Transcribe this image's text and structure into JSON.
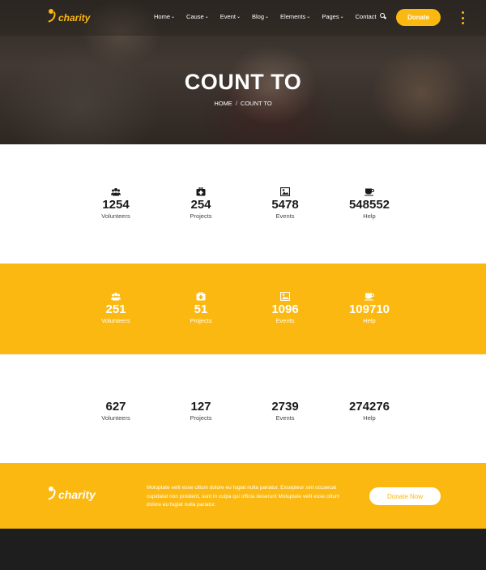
{
  "brand": {
    "name": "charity",
    "accent": "#fbb811"
  },
  "nav": {
    "items": [
      {
        "label": "Home",
        "has_dropdown": true
      },
      {
        "label": "Cause",
        "has_dropdown": true
      },
      {
        "label": "Event",
        "has_dropdown": true
      },
      {
        "label": "Blog",
        "has_dropdown": true
      },
      {
        "label": "Elements",
        "has_dropdown": true
      },
      {
        "label": "Pages",
        "has_dropdown": true
      },
      {
        "label": "Contact",
        "has_dropdown": false
      }
    ],
    "search_icon": "search-icon",
    "donate_label": "Donate",
    "menu_icon": "kebab-menu-icon"
  },
  "hero": {
    "title": "COUNT TO",
    "breadcrumb": [
      "HOME",
      "COUNT TO"
    ],
    "breadcrumb_separator": "/"
  },
  "counter_sections": [
    {
      "background": "#ffffff",
      "items": [
        {
          "icon": "users-icon",
          "value": "1254",
          "label": "Volunteers"
        },
        {
          "icon": "medkit-icon",
          "value": "254",
          "label": "Projects"
        },
        {
          "icon": "image-icon",
          "value": "5478",
          "label": "Events"
        },
        {
          "icon": "coffee-icon",
          "value": "548552",
          "label": "Help"
        }
      ]
    },
    {
      "background": "#fbb811",
      "items": [
        {
          "icon": "users-icon",
          "value": "251",
          "label": "Volunteers"
        },
        {
          "icon": "medkit-icon",
          "value": "51",
          "label": "Projects"
        },
        {
          "icon": "image-icon",
          "value": "1096",
          "label": "Events"
        },
        {
          "icon": "coffee-icon",
          "value": "109710",
          "label": "Help"
        }
      ]
    },
    {
      "background": "#ffffff",
      "items": [
        {
          "value": "627",
          "label": "Volunteers"
        },
        {
          "value": "127",
          "label": "Projects"
        },
        {
          "value": "2739",
          "label": "Events"
        },
        {
          "value": "274276",
          "label": "Help"
        }
      ]
    }
  ],
  "cta": {
    "text": "Moluptate velit esse cillum dolore eu fugiat nulla pariatur. Excepteur sint occaecat cupidatat non proident, sunt in culpa qui officia deserunt Moluptate velit esse cillum dolore eu fugiat nulla pariatur.",
    "button_label": "Donate Now"
  }
}
